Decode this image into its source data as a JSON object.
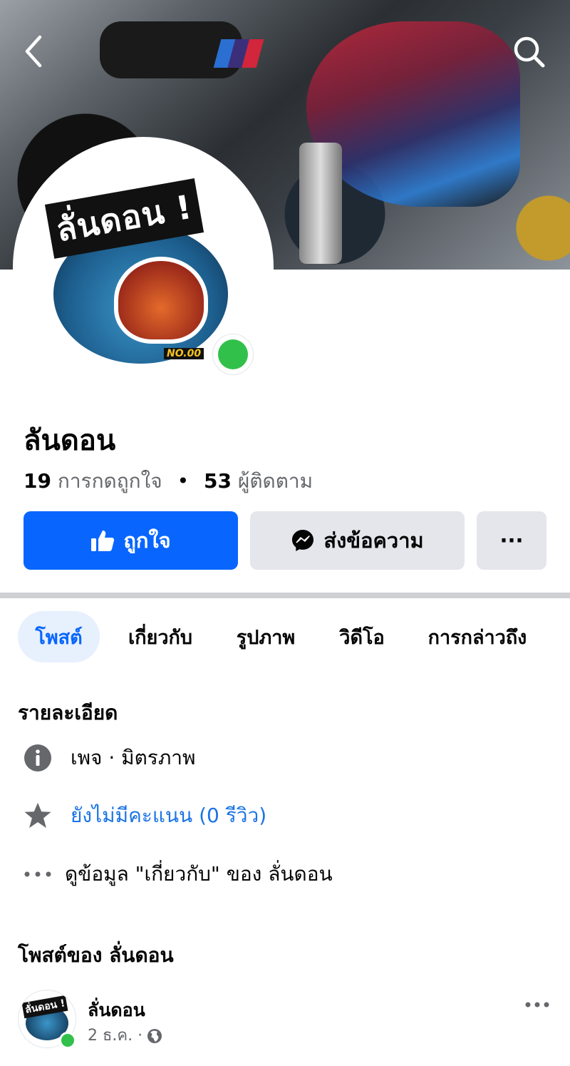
{
  "header": {
    "back_icon": "chevron-left-icon",
    "search_icon": "search-icon"
  },
  "profile": {
    "logo_text": "ลั่นดอน !",
    "logo_badge": "NO.00",
    "name": "ลันดอน",
    "likes_count": "19",
    "likes_label": "การกดถูกใจ",
    "separator": "•",
    "followers_count": "53",
    "followers_label": "ผู้ติดตาม",
    "online_color": "#31c14a"
  },
  "actions": {
    "like_label": "ถูกใจ",
    "message_label": "ส่งข้อความ",
    "more_label": "···",
    "accent": "#0866ff"
  },
  "tabs": [
    {
      "label": "โพสต์",
      "active": true
    },
    {
      "label": "เกี่ยวกับ",
      "active": false
    },
    {
      "label": "รูปภาพ",
      "active": false
    },
    {
      "label": "วิดีโอ",
      "active": false
    },
    {
      "label": "การกล่าวถึง",
      "active": false
    }
  ],
  "details": {
    "title": "รายละเอียด",
    "category": "เพจ · มิตรภาพ",
    "rating": "ยังไม่มีคะแนน (0 รีวิว)",
    "about_link": "ดูข้อมูล \"เกี่ยวกับ\" ของ ลั่นดอน"
  },
  "posts": {
    "title": "โพสต์ของ ลั่นดอน",
    "first": {
      "avatar_text": "ลั่นดอน !",
      "author": "ลั่นดอน",
      "date": "2 ธ.ค. ·"
    }
  }
}
